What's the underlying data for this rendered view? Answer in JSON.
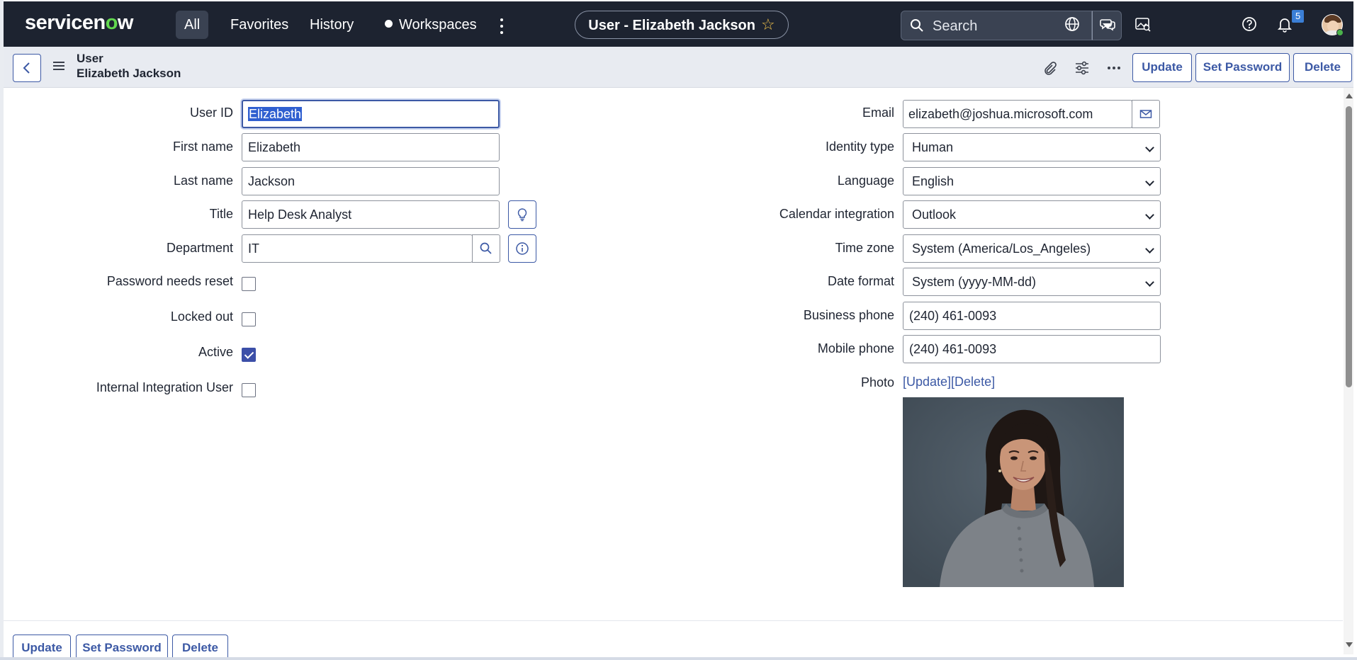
{
  "nav": {
    "logo_prefix": "servicen",
    "logo_o": "o",
    "logo_suffix": "w",
    "tabs": [
      "All",
      "Favorites",
      "History",
      "Workspaces"
    ],
    "record_title": "User - Elizabeth Jackson",
    "search_placeholder": "Search",
    "notification_count": "5"
  },
  "header": {
    "table_label": "User",
    "record_name": "Elizabeth Jackson",
    "buttons": {
      "update": "Update",
      "set_password": "Set Password",
      "delete": "Delete"
    }
  },
  "left_fields": {
    "user_id": {
      "label": "User ID",
      "value": "Elizabeth"
    },
    "first_name": {
      "label": "First name",
      "value": "Elizabeth"
    },
    "last_name": {
      "label": "Last name",
      "value": "Jackson"
    },
    "title": {
      "label": "Title",
      "value": "Help Desk Analyst"
    },
    "department": {
      "label": "Department",
      "value": "IT"
    },
    "password_needs_reset": {
      "label": "Password needs reset",
      "checked": false
    },
    "locked_out": {
      "label": "Locked out",
      "checked": false
    },
    "active": {
      "label": "Active",
      "checked": true
    },
    "internal_integration_user": {
      "label": "Internal Integration User",
      "checked": false
    }
  },
  "right_fields": {
    "email": {
      "label": "Email",
      "value": "elizabeth@joshua.microsoft.com"
    },
    "identity_type": {
      "label": "Identity type",
      "value": "Human"
    },
    "language": {
      "label": "Language",
      "value": "English"
    },
    "calendar_integration": {
      "label": "Calendar integration",
      "value": "Outlook"
    },
    "time_zone": {
      "label": "Time zone",
      "value": "System (America/Los_Angeles)"
    },
    "date_format": {
      "label": "Date format",
      "value": "System (yyyy-MM-dd)"
    },
    "business_phone": {
      "label": "Business phone",
      "value": "(240) 461-0093"
    },
    "mobile_phone": {
      "label": "Mobile phone",
      "value": "(240) 461-0093"
    },
    "photo": {
      "label": "Photo",
      "update_link": "[Update]",
      "delete_link": "[Delete]"
    }
  },
  "footer": {
    "buttons": {
      "update": "Update",
      "set_password": "Set Password",
      "delete": "Delete"
    }
  },
  "colors": {
    "nav_bg": "#1d2330",
    "accent": "#3c59a5",
    "logo_green": "#62d84e",
    "header_bg": "#e8ebf1"
  }
}
